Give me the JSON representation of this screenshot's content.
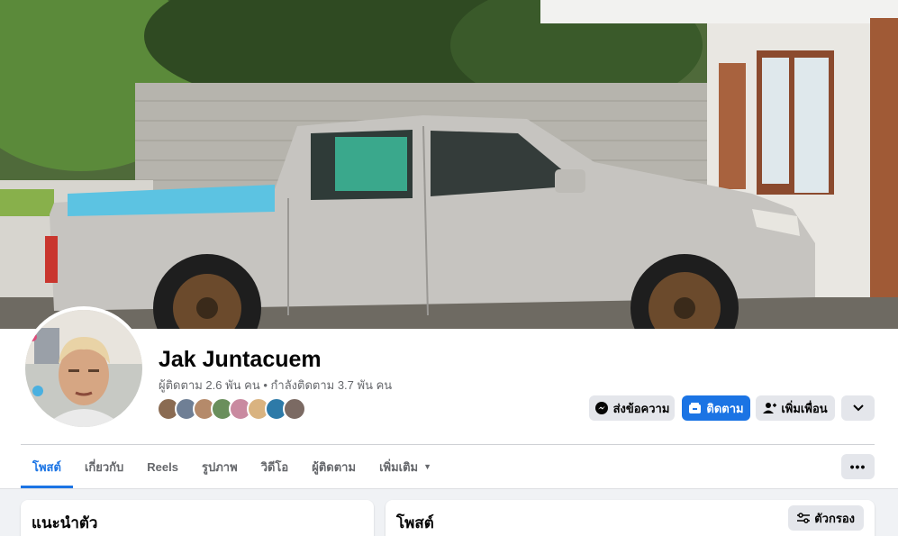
{
  "profile": {
    "name": "Jak Juntacuem",
    "stats": "ผู้ติดตาม 2.6 พัน คน • กำลังติดตาม 3.7 พัน คน"
  },
  "actions": {
    "message_label": "ส่งข้อความ",
    "follow_label": "ติดตาม",
    "add_friend_label": "เพิ่มเพื่อน"
  },
  "tabs": [
    {
      "label": "โพสต์",
      "active": true
    },
    {
      "label": "เกี่ยวกับ"
    },
    {
      "label": "Reels"
    },
    {
      "label": "รูปภาพ"
    },
    {
      "label": "วิดีโอ"
    },
    {
      "label": "ผู้ติดตาม"
    },
    {
      "label": "เพิ่มเติม"
    }
  ],
  "intro_card": {
    "title": "แนะนำตัว"
  },
  "posts_card": {
    "title": "โพสต์",
    "filter_label": "ตัวกรอง"
  },
  "colors": {
    "accent": "#1b74e4",
    "button_gray": "#e4e6eb",
    "text_secondary": "#65676b"
  }
}
